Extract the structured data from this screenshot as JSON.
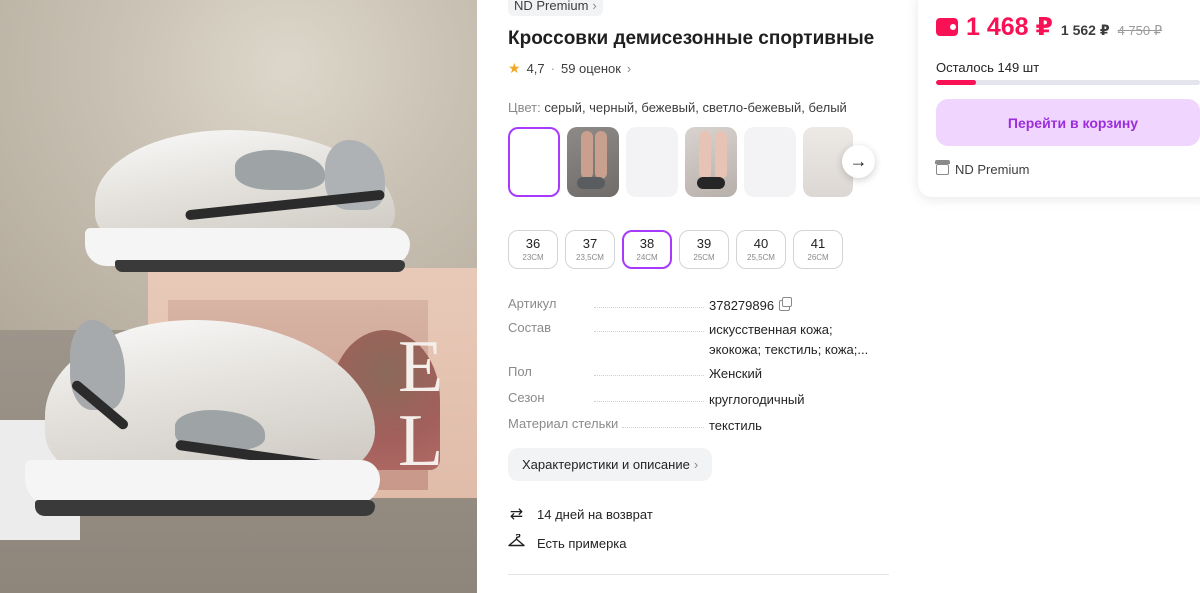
{
  "product": {
    "brand": "ND Premium",
    "title": "Кроссовки демисезонные спортивные",
    "rating": "4,7",
    "reviews": "59 оценок"
  },
  "color": {
    "label": "Цвет:",
    "value": "серый, черный, бежевый, светло-бежевый, белый"
  },
  "sizes": [
    {
      "size": "36",
      "cm": "23СМ",
      "selected": false
    },
    {
      "size": "37",
      "cm": "23,5СМ",
      "selected": false
    },
    {
      "size": "38",
      "cm": "24СМ",
      "selected": true
    },
    {
      "size": "39",
      "cm": "25СМ",
      "selected": false
    },
    {
      "size": "40",
      "cm": "25,5СМ",
      "selected": false
    },
    {
      "size": "41",
      "cm": "26СМ",
      "selected": false
    }
  ],
  "specs": [
    {
      "key": "Артикул",
      "value": "378279896"
    },
    {
      "key": "Состав",
      "value": "искусственная кожа; экокожа; текстиль; кожа;..."
    },
    {
      "key": "Пол",
      "value": "Женский"
    },
    {
      "key": "Сезон",
      "value": "круглогодичный"
    },
    {
      "key": "Материал стельки",
      "value": "текстиль"
    }
  ],
  "characteristics_button": "Характеристики и описание",
  "features": [
    {
      "icon": "return-icon",
      "text": "14 дней на возврат"
    },
    {
      "icon": "hanger-icon",
      "text": "Есть примерка"
    }
  ],
  "buy": {
    "price": "1 468 ₽",
    "price_no_wallet": "1 562 ₽",
    "price_old": "4 750 ₽",
    "stock": "Осталось 149 шт",
    "stock_fraction": 0.15,
    "cart_button": "Перейти в корзину",
    "seller": "ND Premium"
  },
  "colors": {
    "accent": "#a73afd",
    "price": "#f91155",
    "cart_bg": "#f0d6ff",
    "cart_text": "#9b2ddb"
  }
}
